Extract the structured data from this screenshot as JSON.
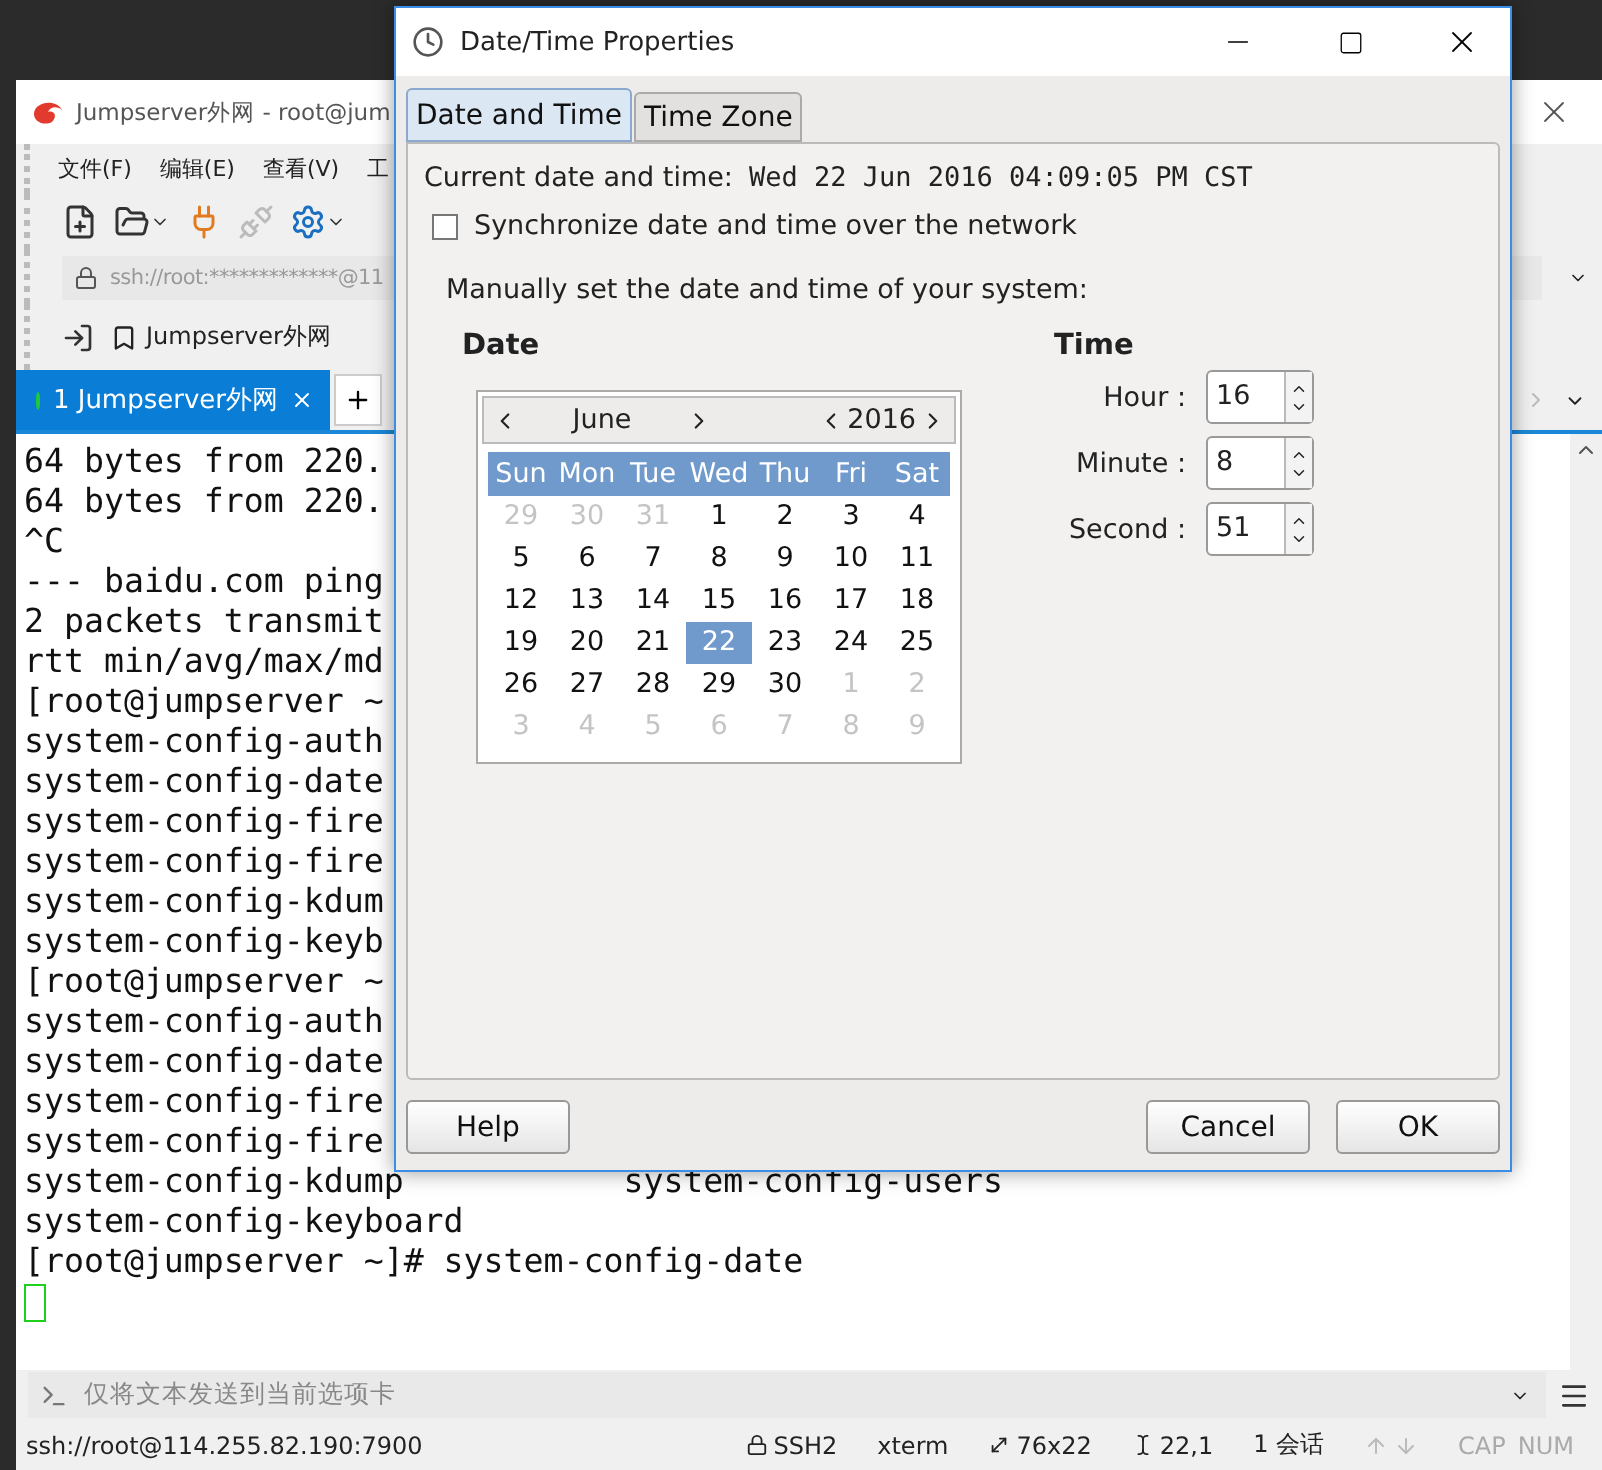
{
  "terminal_window": {
    "title": "Jumpserver外网 - root@jum",
    "menu": [
      "文件(F)",
      "编辑(E)",
      "查看(V)",
      "工"
    ],
    "address": "ssh://root:*************@11",
    "bookmarks": [
      {
        "label": "Jumpserver外网"
      }
    ],
    "tabs": [
      {
        "label": "1 Jumpserver外网",
        "selected": true
      }
    ],
    "lines": [
      "64 bytes from 220.",
      "64 bytes from 220.",
      "^C",
      "--- baidu.com ping",
      "2 packets transmit",
      "rtt min/avg/max/md",
      "[root@jumpserver ~",
      "system-config-auth",
      "system-config-date",
      "system-config-fire",
      "system-config-fire",
      "system-config-kdum",
      "system-config-keyb",
      "[root@jumpserver ~",
      "system-config-auth",
      "system-config-date",
      "system-config-fire",
      "system-config-fire",
      "system-config-kdump           system-config-users",
      "system-config-keyboard",
      "[root@jumpserver ~]# system-config-date"
    ],
    "input_placeholder": "仅将文本发送到当前选项卡",
    "status_bar": {
      "address": "ssh://root@114.255.82.190:7900",
      "protocol": "SSH2",
      "terminal": "xterm",
      "size": "76x22",
      "cursor": "22,1",
      "sessions": "1 会话",
      "caps": "CAP",
      "num": "NUM"
    }
  },
  "dialog": {
    "title": "Date/Time Properties",
    "tabs": [
      {
        "label": "Date and Time",
        "selected": true
      },
      {
        "label": "Time Zone",
        "selected": false
      }
    ],
    "current_label": "Current date and time:",
    "current_value": "Wed 22 Jun 2016 04:09:05 PM CST",
    "sync": {
      "label": "Synchronize date and time over the network",
      "checked": false
    },
    "manual_label": "Manually set the date and time of your system:",
    "date": {
      "heading": "Date",
      "month": "June",
      "year": "2016",
      "weekdays": [
        "Sun",
        "Mon",
        "Tue",
        "Wed",
        "Thu",
        "Fri",
        "Sat"
      ],
      "days": [
        {
          "text": "29",
          "other_month": true,
          "selected": false
        },
        {
          "text": "30",
          "other_month": true,
          "selected": false
        },
        {
          "text": "31",
          "other_month": true,
          "selected": false
        },
        {
          "text": "1",
          "other_month": false,
          "selected": false
        },
        {
          "text": "2",
          "other_month": false,
          "selected": false
        },
        {
          "text": "3",
          "other_month": false,
          "selected": false
        },
        {
          "text": "4",
          "other_month": false,
          "selected": false
        },
        {
          "text": "5",
          "other_month": false,
          "selected": false
        },
        {
          "text": "6",
          "other_month": false,
          "selected": false
        },
        {
          "text": "7",
          "other_month": false,
          "selected": false
        },
        {
          "text": "8",
          "other_month": false,
          "selected": false
        },
        {
          "text": "9",
          "other_month": false,
          "selected": false
        },
        {
          "text": "10",
          "other_month": false,
          "selected": false
        },
        {
          "text": "11",
          "other_month": false,
          "selected": false
        },
        {
          "text": "12",
          "other_month": false,
          "selected": false
        },
        {
          "text": "13",
          "other_month": false,
          "selected": false
        },
        {
          "text": "14",
          "other_month": false,
          "selected": false
        },
        {
          "text": "15",
          "other_month": false,
          "selected": false
        },
        {
          "text": "16",
          "other_month": false,
          "selected": false
        },
        {
          "text": "17",
          "other_month": false,
          "selected": false
        },
        {
          "text": "18",
          "other_month": false,
          "selected": false
        },
        {
          "text": "19",
          "other_month": false,
          "selected": false
        },
        {
          "text": "20",
          "other_month": false,
          "selected": false
        },
        {
          "text": "21",
          "other_month": false,
          "selected": false
        },
        {
          "text": "22",
          "other_month": false,
          "selected": true
        },
        {
          "text": "23",
          "other_month": false,
          "selected": false
        },
        {
          "text": "24",
          "other_month": false,
          "selected": false
        },
        {
          "text": "25",
          "other_month": false,
          "selected": false
        },
        {
          "text": "26",
          "other_month": false,
          "selected": false
        },
        {
          "text": "27",
          "other_month": false,
          "selected": false
        },
        {
          "text": "28",
          "other_month": false,
          "selected": false
        },
        {
          "text": "29",
          "other_month": false,
          "selected": false
        },
        {
          "text": "30",
          "other_month": false,
          "selected": false
        },
        {
          "text": "1",
          "other_month": true,
          "selected": false
        },
        {
          "text": "2",
          "other_month": true,
          "selected": false
        },
        {
          "text": "3",
          "other_month": true,
          "selected": false
        },
        {
          "text": "4",
          "other_month": true,
          "selected": false
        },
        {
          "text": "5",
          "other_month": true,
          "selected": false
        },
        {
          "text": "6",
          "other_month": true,
          "selected": false
        },
        {
          "text": "7",
          "other_month": true,
          "selected": false
        },
        {
          "text": "8",
          "other_month": true,
          "selected": false
        },
        {
          "text": "9",
          "other_month": true,
          "selected": false
        }
      ]
    },
    "time": {
      "heading": "Time",
      "fields": [
        {
          "label": "Hour :",
          "value": "16"
        },
        {
          "label": "Minute :",
          "value": "8"
        },
        {
          "label": "Second :",
          "value": "51"
        }
      ]
    },
    "left_buttons": [
      "Help"
    ],
    "right_buttons": [
      "Cancel",
      "OK"
    ]
  }
}
